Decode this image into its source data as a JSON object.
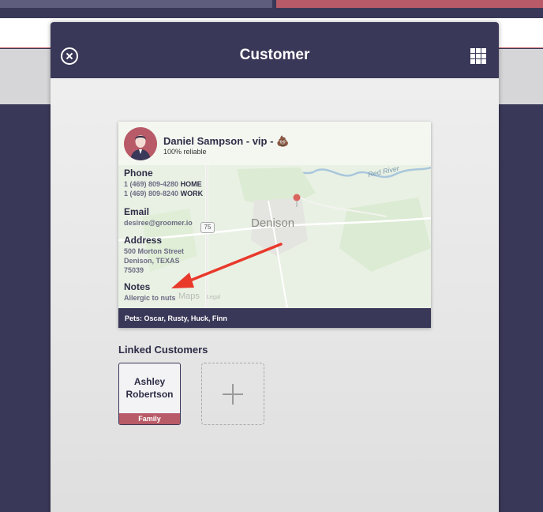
{
  "modal": {
    "title": "Customer"
  },
  "customer": {
    "name": "Daniel Sampson - vip -",
    "name_emoji": "💩",
    "reliability": "100% reliable",
    "phone": {
      "title": "Phone",
      "numbers": [
        {
          "number": "1 (469) 809-4280",
          "type": "HOME"
        },
        {
          "number": "1 (469) 809-8240",
          "type": "WORK"
        }
      ]
    },
    "email": {
      "title": "Email",
      "value": "desiree@groomer.io"
    },
    "address": {
      "title": "Address",
      "lines": [
        "500 Morton Street",
        "Denison, TEXAS",
        "75039"
      ]
    },
    "notes": {
      "title": "Notes",
      "value": "Allergic to nuts"
    },
    "pets": "Pets: Oscar, Rusty, Huck, Finn"
  },
  "map": {
    "city_label": "Denison",
    "river_label": "Red River",
    "route_shield": "75",
    "attribution": "Maps",
    "legal": "Legal"
  },
  "linked": {
    "title": "Linked Customers",
    "customers": [
      {
        "first": "Ashley",
        "last": "Robertson",
        "relation": "Family"
      }
    ]
  },
  "colors": {
    "primary": "#3a3858",
    "accent": "#b85a67",
    "annotation_arrow": "#e8392b"
  },
  "icons": {
    "close": "close-circle-icon",
    "grid": "grid-icon",
    "add": "plus-icon",
    "location": "map-pin-icon"
  }
}
